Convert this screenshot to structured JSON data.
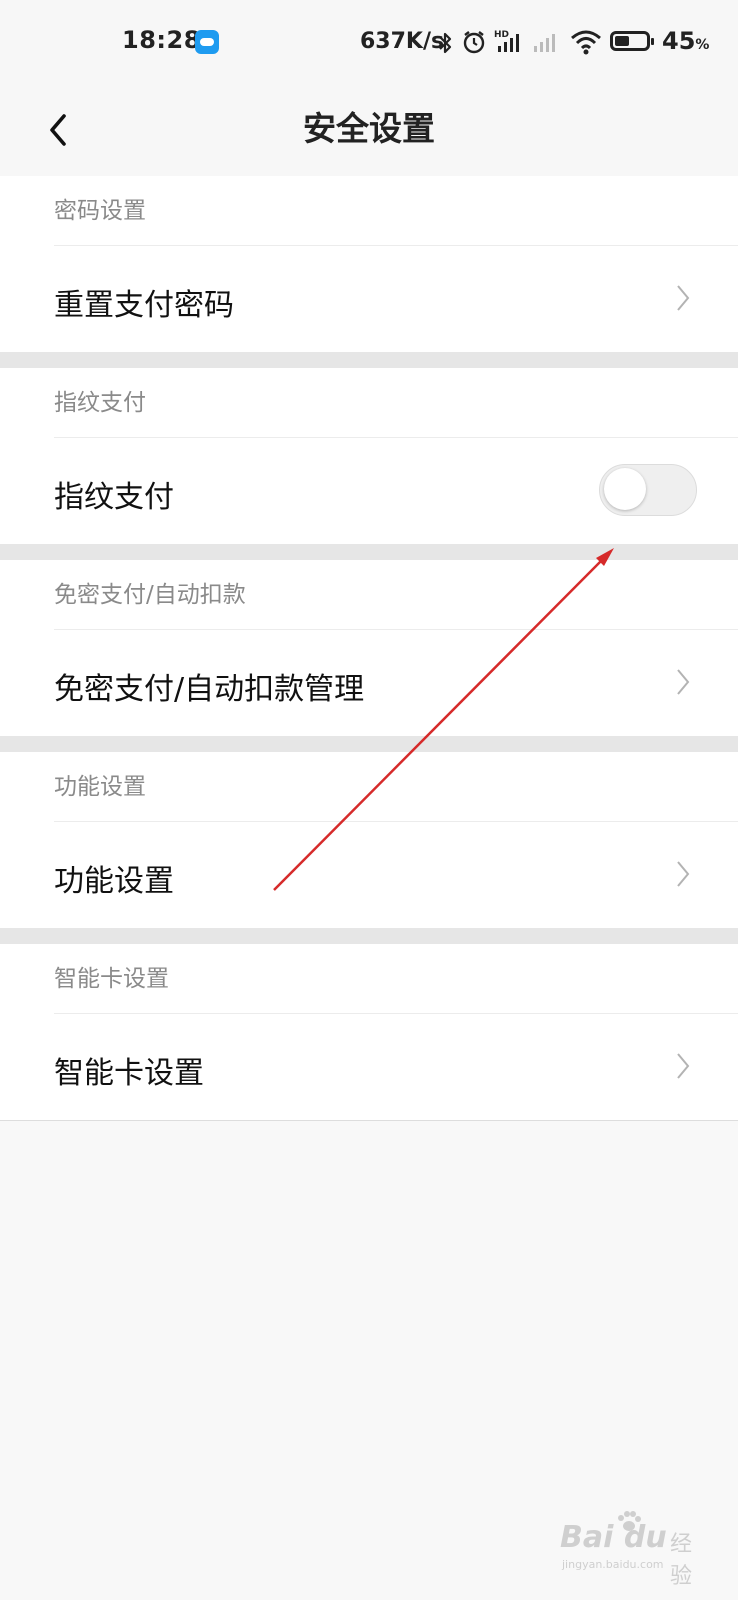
{
  "status_bar": {
    "time": "18:28",
    "net_speed": "637K/s",
    "battery_percent": "45",
    "battery_unit": "%",
    "battery_level": 0.45,
    "icons": [
      "cloud-app-icon",
      "bluetooth-icon",
      "alarm-icon",
      "hd-signal-icon",
      "signal-icon",
      "wifi-icon",
      "battery-icon"
    ]
  },
  "nav": {
    "title": "安全设置",
    "back_icon": "back-arrow-icon"
  },
  "sections": [
    {
      "header": "密码设置",
      "row_label": "重置支付密码",
      "control": "chevron"
    },
    {
      "header": "指纹支付",
      "row_label": "指纹支付",
      "control": "toggle",
      "toggle_on": false
    },
    {
      "header": "免密支付/自动扣款",
      "row_label": "免密支付/自动扣款管理",
      "control": "chevron"
    },
    {
      "header": "功能设置",
      "row_label": "功能设置",
      "control": "chevron"
    },
    {
      "header": "智能卡设置",
      "row_label": "智能卡设置",
      "control": "chevron"
    }
  ],
  "colors": {
    "annotation_arrow": "#d62a2a",
    "section_header_text": "#8a8a8a",
    "divider_band": "#e6e6e6"
  },
  "watermark": {
    "logo_text": "Bai du",
    "suffix": "经验",
    "url": "jingyan.baidu.com"
  }
}
